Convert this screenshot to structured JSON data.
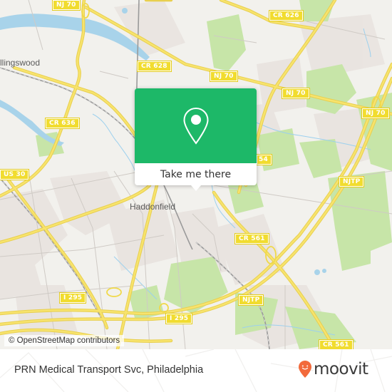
{
  "map": {
    "place_labels": [
      {
        "id": "collingswood",
        "text": "llingswood"
      },
      {
        "id": "haddonfield",
        "text": "Haddonfield"
      }
    ],
    "road_shields": [
      {
        "id": "nj70-top",
        "text": "NJ 70"
      },
      {
        "id": "cr626",
        "text": "CR 626"
      },
      {
        "id": "cr628",
        "text": "CR 628"
      },
      {
        "id": "nj70-a",
        "text": "NJ 70"
      },
      {
        "id": "nj70-b",
        "text": "NJ 70"
      },
      {
        "id": "nj70-c",
        "text": "NJ 70"
      },
      {
        "id": "cr636",
        "text": "CR 636"
      },
      {
        "id": "us30",
        "text": "US 30"
      },
      {
        "id": "cr554",
        "text": "54"
      },
      {
        "id": "njtp-a",
        "text": "NJTP"
      },
      {
        "id": "cr561-a",
        "text": "CR 561"
      },
      {
        "id": "i295-a",
        "text": "I 295"
      },
      {
        "id": "i295-b",
        "text": "I 295"
      },
      {
        "id": "njtp-b",
        "text": "NJTP"
      },
      {
        "id": "cr561-b",
        "text": "CR 561"
      }
    ],
    "attribution": "© OpenStreetMap contributors"
  },
  "popup": {
    "icon": "map-pin-icon",
    "cta_label": "Take me there",
    "accent_color": "#1db868"
  },
  "footer": {
    "title": "PRN Medical Transport Svc, Philadelphia",
    "logo_text": "moovit",
    "logo_icon": "moovit-pin-smile-icon",
    "brand_color": "#f26a3b"
  }
}
